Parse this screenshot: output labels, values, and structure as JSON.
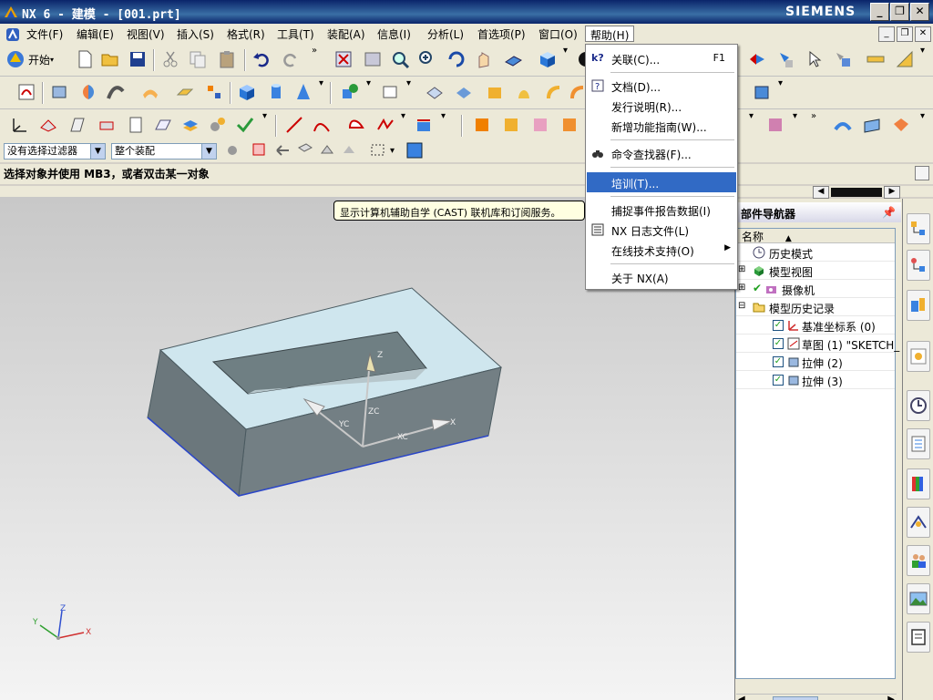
{
  "window": {
    "title": "NX 6 - 建模 - [001.prt]",
    "brand": "SIEMENS"
  },
  "menubar": {
    "items": [
      "文件(F)",
      "编辑(E)",
      "视图(V)",
      "插入(S)",
      "格式(R)",
      "工具(T)",
      "装配(A)",
      "信息(I)",
      "分析(L)",
      "首选项(P)",
      "窗口(O)",
      "帮助(H)"
    ]
  },
  "toolbar": {
    "start_label": "开始"
  },
  "selection": {
    "filter": "没有选择过滤器",
    "scope": "整个装配"
  },
  "status": {
    "prompt": "选择对象并使用 MB3，或者双击某一对象"
  },
  "help_menu": {
    "items": [
      {
        "label": "关联(C)...",
        "shortcut": "F1",
        "icon": "context-help-icon"
      },
      {
        "label": "文档(D)...",
        "icon": "documentation-icon"
      },
      {
        "label": "发行说明(R)..."
      },
      {
        "label": "新增功能指南(W)..."
      },
      {
        "label": "命令查找器(F)...",
        "icon": "binoculars-icon"
      },
      {
        "label": "培训(T)...",
        "highlighted": true
      },
      {
        "label": "捕捉事件报告数据(I)"
      },
      {
        "label": "NX 日志文件(L)",
        "icon": "log-file-icon"
      },
      {
        "label": "在线技术支持(O)",
        "submenu": true
      },
      {
        "label": "关于 NX(A)"
      }
    ]
  },
  "tooltip": {
    "text": "显示计算机辅助自学 (CAST) 联机库和订阅服务。"
  },
  "navigator": {
    "title": "部件导航器",
    "column": "名称",
    "rows": [
      {
        "label": "历史模式",
        "icon": "clock-icon"
      },
      {
        "label": "模型视图",
        "icon": "model-views-icon"
      },
      {
        "label": "摄像机",
        "icon": "camera-icon"
      },
      {
        "label": "模型历史记录",
        "icon": "folder-icon"
      },
      {
        "label": "基准坐标系 (0)",
        "icon": "datum-csys-icon"
      },
      {
        "label": "草图 (1) \"SKETCH_",
        "icon": "sketch-icon"
      },
      {
        "label": "拉伸 (2)",
        "icon": "extrude-icon"
      },
      {
        "label": "拉伸 (3)",
        "icon": "extrude-icon"
      }
    ]
  },
  "viewport": {
    "axis_labels": {
      "x": "X",
      "y": "Y",
      "z": "Z",
      "xc": "XC",
      "yc": "YC",
      "zc": "ZC"
    },
    "colors": {
      "top_face": "#cfe6ee",
      "side_face": "#6f7f83",
      "edge": "#2b46c8"
    }
  }
}
